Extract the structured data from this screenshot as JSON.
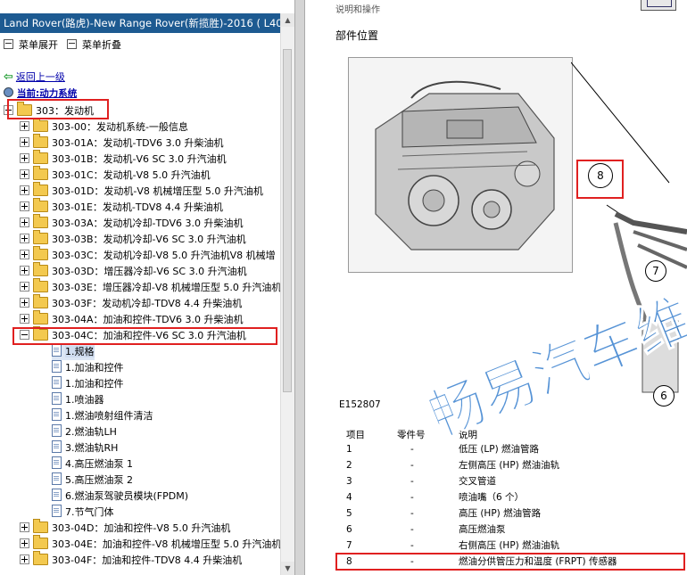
{
  "window_title": "Land Rover(路虎)-New Range Rover(新揽胜)-2016 ( L40",
  "menu": {
    "expand_label": "菜单展开",
    "collapse_label": "菜单折叠"
  },
  "nav": {
    "back_label": "返回上一级",
    "current_label": "当前:动力系统"
  },
  "tree": {
    "root": "303：发动机",
    "items": [
      "303-00：发动机系统-一般信息",
      "303-01A：发动机-TDV6 3.0 升柴油机",
      "303-01B：发动机-V6 SC 3.0 升汽油机",
      "303-01C：发动机-V8 5.0 升汽油机",
      "303-01D：发动机-V8 机械增压型 5.0 升汽油机",
      "303-01E：发动机-TDV8 4.4 升柴油机",
      "303-03A：发动机冷却-TDV6 3.0 升柴油机",
      "303-03B：发动机冷却-V6 SC 3.0 升汽油机",
      "303-03C：发动机冷却-V8 5.0 升汽油机V8 机械增",
      "303-03D：增压器冷却-V6 SC 3.0 升汽油机",
      "303-03E：增压器冷却-V8 机械增压型 5.0 升汽油机",
      "303-03F：发动机冷却-TDV8 4.4 升柴油机",
      "303-04A：加油和控件-TDV6 3.0 升柴油机"
    ],
    "open_item": "303-04C：加油和控件-V6 SC 3.0 升汽油机",
    "children": [
      "1.规格",
      "1.加油和控件",
      "1.加油和控件",
      "1.喷油器",
      "1.燃油喷射组件清洁",
      "2.燃油轨LH",
      "3.燃油轨RH",
      "4.高压燃油泵 1",
      "5.高压燃油泵 2",
      "6.燃油泵驾驶员模块(FPDM)",
      "7.节气门体"
    ],
    "after_items": [
      "303-04D：加油和控件-V8 5.0 升汽油机",
      "303-04E：加油和控件-V8 机械增压型 5.0 升汽油机",
      "303-04F：加油和控件-TDV8 4.4 升柴油机"
    ]
  },
  "document": {
    "top_cut_text": "说明和操作",
    "section_title": "部件位置",
    "figure_code": "E152807",
    "callouts": [
      "8",
      "7",
      "6"
    ],
    "table_headers": [
      "项目",
      "零件号",
      "说明"
    ],
    "table_rows": [
      [
        "1",
        "-",
        "低压 (LP) 燃油管路"
      ],
      [
        "2",
        "-",
        "左侧高压 (HP) 燃油油轨"
      ],
      [
        "3",
        "-",
        "交叉管道"
      ],
      [
        "4",
        "-",
        "喷油嘴（6 个）"
      ],
      [
        "5",
        "-",
        "高压 (HP) 燃油管路"
      ],
      [
        "6",
        "-",
        "高压燃油泵"
      ],
      [
        "7",
        "-",
        "右侧高压 (HP) 燃油油轨"
      ],
      [
        "8",
        "-",
        "燃油分供管压力和温度 (FRPT) 传感器"
      ]
    ],
    "watermark": "畅易汽车维修"
  },
  "colors": {
    "title_bar": "#1d5a91",
    "highlight": "#e02020",
    "folder": "#f3c94f",
    "watermark": "#1e6fc8"
  }
}
